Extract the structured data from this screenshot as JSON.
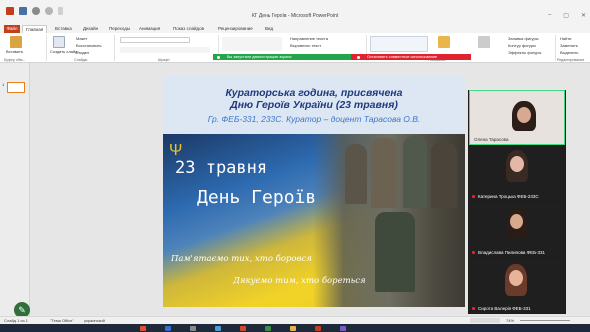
{
  "window": {
    "title": "КГ День Героїв - Microsoft PowerPoint",
    "controls": [
      "–",
      "▢",
      "✕"
    ]
  },
  "quick_access": [
    "save-icon",
    "undo-icon",
    "redo-icon",
    "customize-icon"
  ],
  "tabs": [
    {
      "label": "Файл"
    },
    {
      "label": "Главная"
    },
    {
      "label": "Вставка"
    },
    {
      "label": "Дизайн"
    },
    {
      "label": "Переходы"
    },
    {
      "label": "Анимация"
    },
    {
      "label": "Показ слайдов"
    },
    {
      "label": "Рецензирование"
    },
    {
      "label": "Вид"
    }
  ],
  "ribbon": {
    "paste": "Вставить",
    "new_slide": "Создать слайд",
    "layout": "Макет",
    "reset": "Восстановить",
    "section": "Раздел",
    "groups": {
      "clipboard": "Буфер обм...",
      "slides": "Слайды",
      "font": "Шрифт",
      "paragraph": "Абзац",
      "drawing": "Рисование",
      "editing": "Редактирование"
    },
    "text_direction": "Направление текста",
    "align_text": "Выровнять текст",
    "smartart": "Преобразовать в SmartArt",
    "shape_fill": "Заливка фигуры",
    "shape_outline": "Контур фигуры",
    "shape_effects": "Эффекты фигуры",
    "find": "Найти",
    "replace": "Заменить",
    "select": "Выделить"
  },
  "sharing": {
    "screen_notice": "Вы запустили демонстрацию экрана",
    "stop_label": "Остановить совместное использование"
  },
  "thumbnail": {
    "number": "1"
  },
  "slide": {
    "title_line1": "Кураторська година, присвячена",
    "title_line2": "Дню Героїв України (23 травня)",
    "subtitle": "Гр. ФЕБ-331, 233С. Куратор – доцент Тарасова О.В.",
    "date": "23 травня",
    "day": "День Героїв",
    "memory_line1": "Пам'ятаємо тих, хто боровся",
    "memory_line2": "Дякуємо тим, хто бореться"
  },
  "video": {
    "participants": [
      {
        "name": "Олена Тарасова",
        "mic": false
      },
      {
        "name": "Катерина Троцька ФЕБ-233С",
        "mic": true
      },
      {
        "name": "Владислава Пилипова ФЕБ-331",
        "mic": true
      },
      {
        "name": "Сирота Валерія ФЕБ-331",
        "mic": true
      }
    ]
  },
  "status": {
    "slide_info": "Слайд 1 из 1",
    "theme": "\"Тема Office\"",
    "language": "украинский",
    "zoom": "74%"
  }
}
